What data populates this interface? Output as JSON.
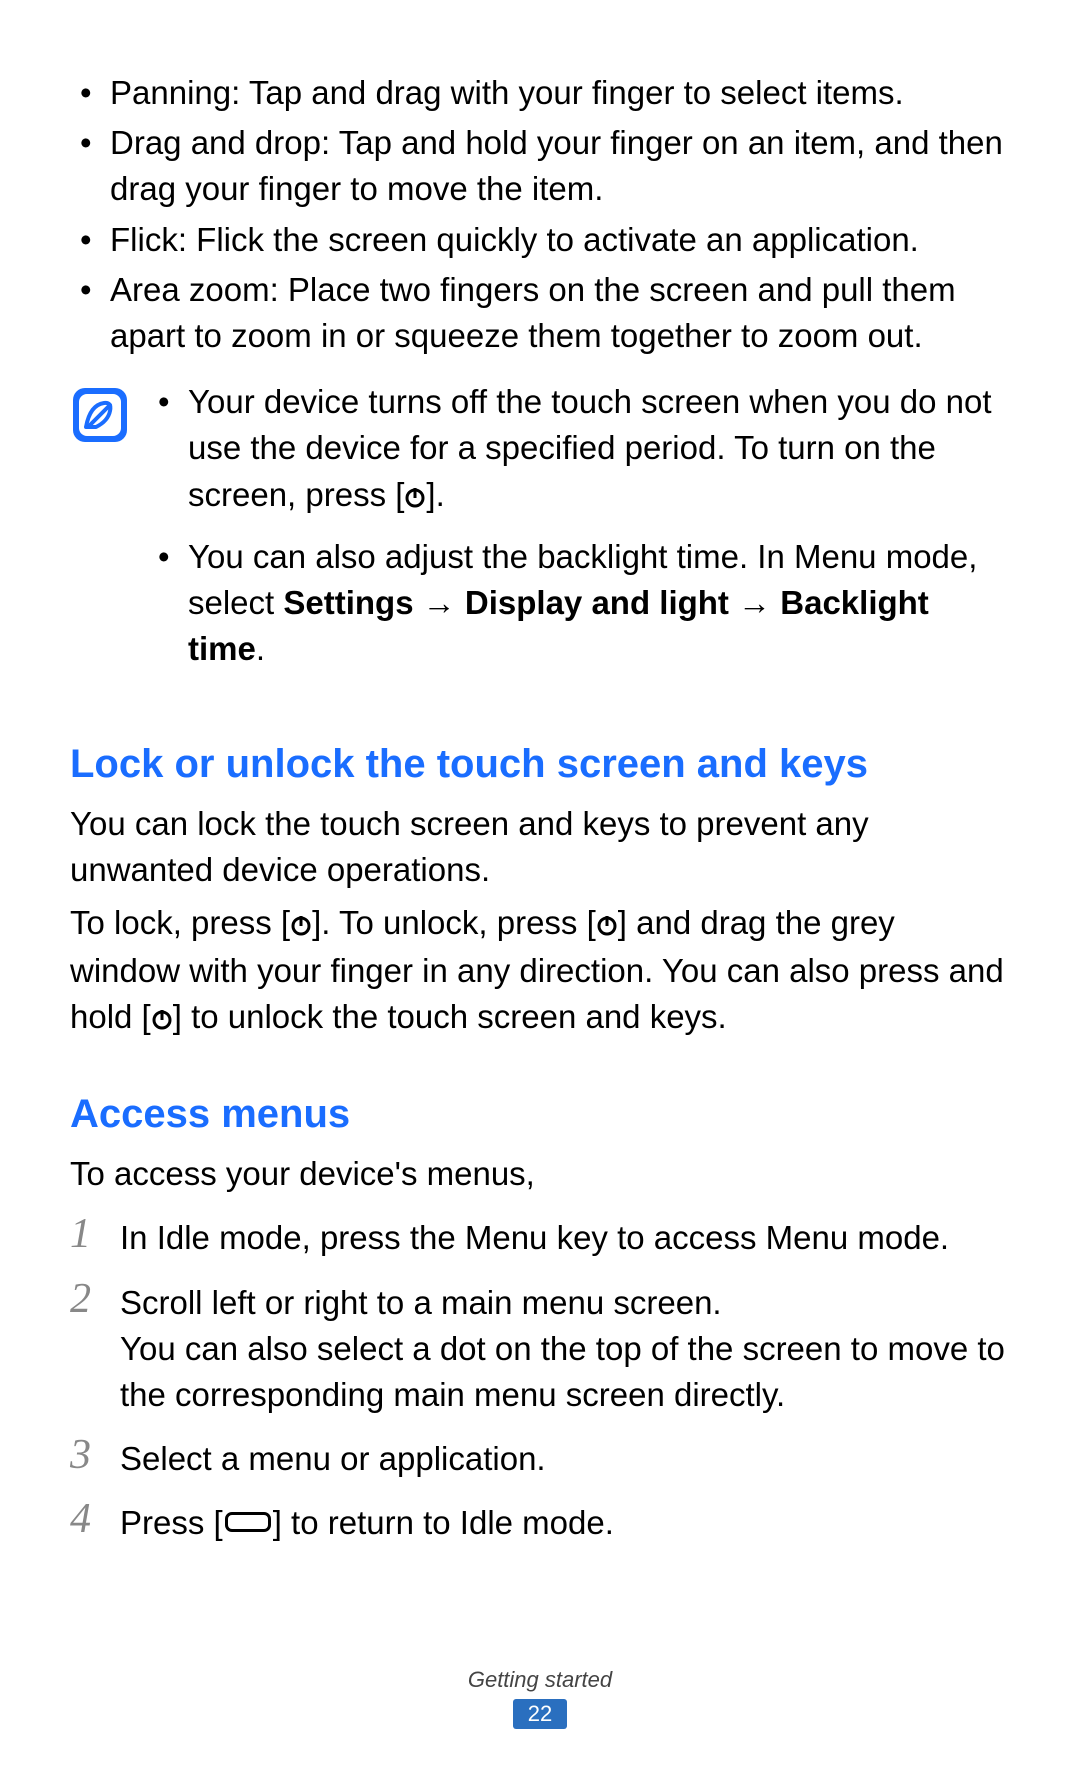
{
  "top_bullets": [
    "Panning: Tap and drag with your finger to select items.",
    "Drag and drop: Tap and hold your finger on an item, and then drag your finger to move the item.",
    "Flick: Flick the screen quickly to activate an application.",
    "Area zoom: Place two fingers on the screen and pull them apart to zoom in or squeeze them together to zoom out."
  ],
  "note": {
    "bullets": [
      {
        "pre": "Your device turns off the touch screen when you do not use the device for a specified period. To turn on the screen, press [",
        "icon": "power",
        "post": "]."
      },
      {
        "pre": "You can also adjust the backlight time. In Menu mode, select ",
        "bold": "Settings → Display and light → Backlight time",
        "post": "."
      }
    ]
  },
  "lock": {
    "heading": "Lock or unlock the touch screen and keys",
    "p1": "You can lock the touch screen and keys to prevent any unwanted device operations.",
    "p2_a": "To lock, press [",
    "p2_b": "]. To unlock, press [",
    "p2_c": "] and drag the grey window with your finger in any direction. You can also press and hold [",
    "p2_d": "] to unlock the touch screen and keys."
  },
  "access": {
    "heading": "Access menus",
    "intro": "To access your device's menus,",
    "steps": [
      {
        "n": "1",
        "text_a": "In Idle mode, press the Menu key to access Menu mode."
      },
      {
        "n": "2",
        "text_a": "Scroll left or right to a main menu screen.",
        "text_b": "You can also select a dot on the top of the screen to move to the corresponding main menu screen directly."
      },
      {
        "n": "3",
        "text_a": "Select a menu or application."
      },
      {
        "n": "4",
        "text_a": "Press [",
        "key": true,
        "text_c": "] to return to Idle mode."
      }
    ]
  },
  "footer": {
    "section": "Getting started",
    "page": "22"
  }
}
